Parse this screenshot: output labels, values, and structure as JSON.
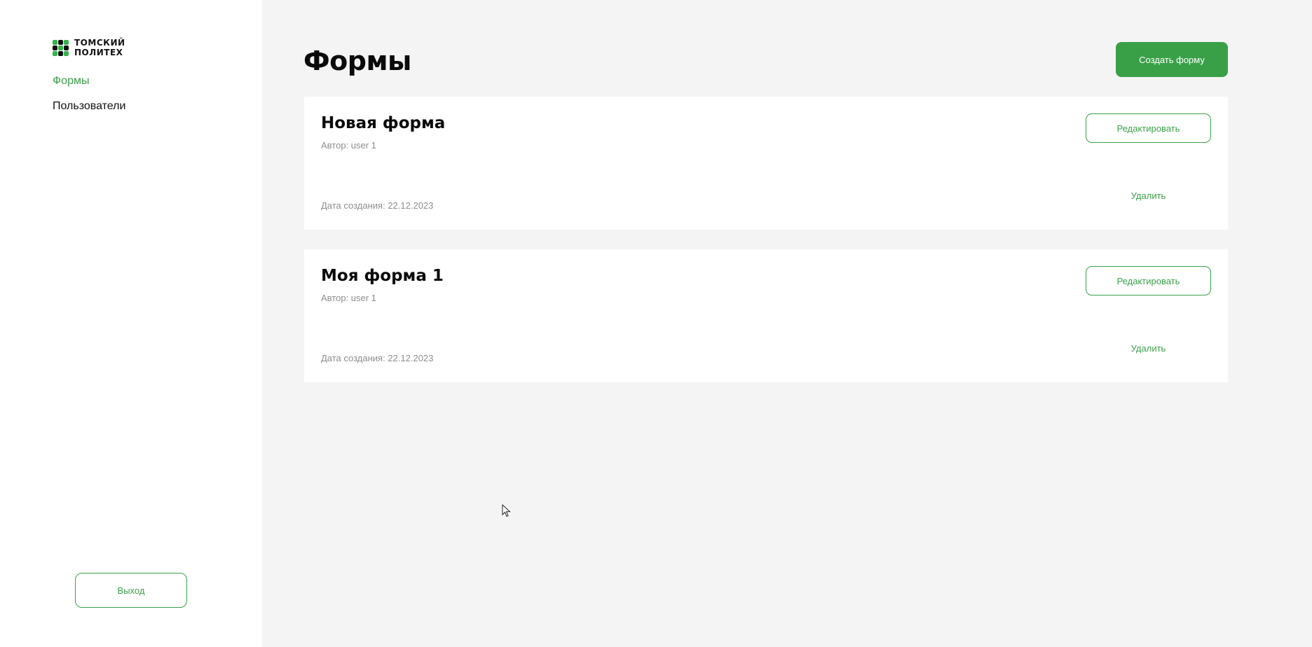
{
  "sidebar": {
    "logo": {
      "line1": "ТОМСКИЙ",
      "line2": "ПОЛИТЕХ"
    },
    "nav": [
      {
        "label": "Формы",
        "active": true
      },
      {
        "label": "Пользователи",
        "active": false
      }
    ],
    "logout_label": "Выход"
  },
  "main": {
    "title": "Формы",
    "create_button": "Создать форму",
    "forms": [
      {
        "title": "Новая форма",
        "author": "Автор: user 1",
        "created": "Дата создания: 22.12.2023",
        "edit_label": "Редактировать",
        "delete_label": "Удалить"
      },
      {
        "title": "Моя форма 1",
        "author": "Автор: user 1",
        "created": "Дата создания: 22.12.2023",
        "edit_label": "Редактировать",
        "delete_label": "Удалить"
      }
    ]
  },
  "colors": {
    "accent": "#3aa048",
    "background": "#f4f4f4",
    "card": "#ffffff",
    "muted_text": "#8d8d8d"
  },
  "icons": [
    "logo-mark-icon",
    "mouse-cursor-icon"
  ]
}
